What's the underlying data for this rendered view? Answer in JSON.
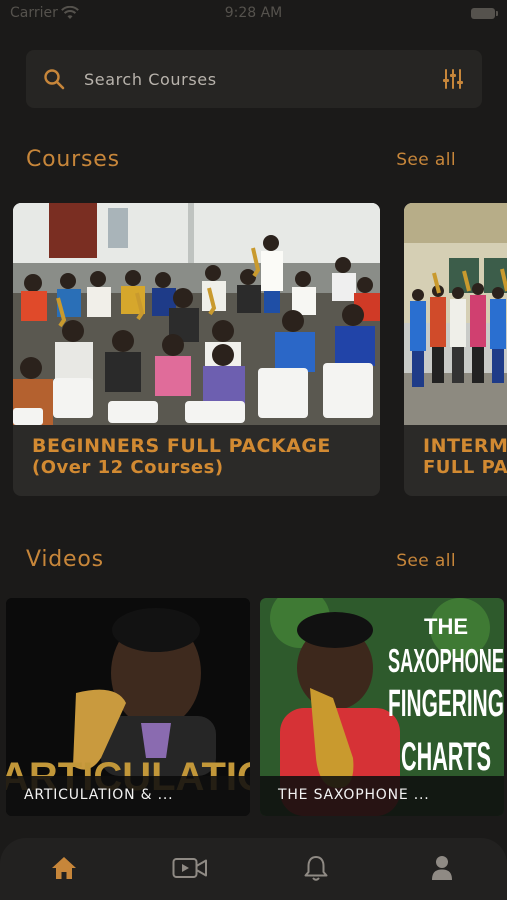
{
  "status_bar": {
    "carrier": "Carrier",
    "time": "9:28 AM",
    "icons": [
      "wifi-icon",
      "battery-icon"
    ]
  },
  "search": {
    "placeholder": "Search Courses",
    "icons": [
      "search-icon",
      "filter-icon"
    ]
  },
  "courses_section": {
    "title": "Courses",
    "see_all": "See all",
    "cards": [
      {
        "title": "BEGINNERS FULL PACKAGE",
        "subtitle": "(Over 12 Courses)",
        "image": "saxophone class in hall photo"
      },
      {
        "title": "INTERM",
        "subtitle": "FULL PA",
        "image": "saxophone group outdoors photo"
      }
    ]
  },
  "videos_section": {
    "title": "Videos",
    "see_all": "See all",
    "cards": [
      {
        "label": "ARTICULATION & ...",
        "overlay_text": "ARTICULATION"
      },
      {
        "label": "THE SAXOPHONE ...",
        "overlay_lines": [
          "THE",
          "SAXOPHONE",
          "FINGERING",
          "CHARTS"
        ]
      }
    ]
  },
  "tab_bar": {
    "active": "home",
    "tabs": [
      {
        "name": "home",
        "icon": "home-icon"
      },
      {
        "name": "videos",
        "icon": "video-camera-icon"
      },
      {
        "name": "notifications",
        "icon": "bell-icon"
      },
      {
        "name": "profile",
        "icon": "user-icon"
      }
    ]
  },
  "colors": {
    "background": "#1b1a19",
    "surface": "#262523",
    "accent": "#c7863a",
    "tab_inactive": "#8f8a84"
  }
}
